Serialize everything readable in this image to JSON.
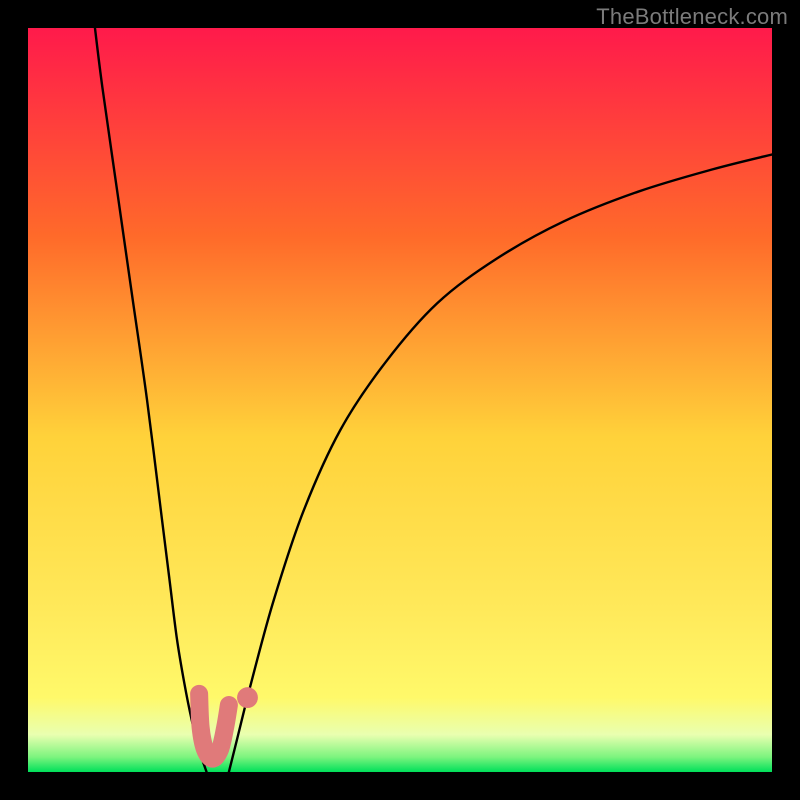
{
  "watermark": "TheBottleneck.com",
  "chart_data": {
    "type": "line",
    "title": "",
    "xlabel": "",
    "ylabel": "",
    "xlim": [
      0,
      100
    ],
    "ylim": [
      0,
      100
    ],
    "grid": false,
    "gradient": {
      "top": "#ff1a4b",
      "upper_mid": "#ff7a2a",
      "mid": "#ffd23a",
      "lower_mid": "#fff96a",
      "pale": "#e9ffb0",
      "bottom": "#00e05a"
    },
    "series": [
      {
        "name": "left-branch",
        "stroke": "#000000",
        "x": [
          9,
          10,
          12,
          14,
          16,
          18,
          19,
          20,
          21,
          22,
          23,
          24
        ],
        "y": [
          100,
          92,
          78,
          64,
          50,
          34,
          26,
          18,
          12,
          7,
          3,
          0
        ]
      },
      {
        "name": "right-branch",
        "stroke": "#000000",
        "x": [
          27,
          28,
          30,
          33,
          37,
          42,
          48,
          55,
          63,
          72,
          82,
          92,
          100
        ],
        "y": [
          0,
          4,
          12,
          23,
          35,
          46,
          55,
          63,
          69,
          74,
          78,
          81,
          83
        ]
      }
    ],
    "markers": [
      {
        "name": "left-marker",
        "type": "rounded-u",
        "stroke": "#e07a7a",
        "x": [
          23.0,
          23.2,
          23.8,
          24.8,
          25.8,
          26.5,
          27.0
        ],
        "y": [
          10.5,
          6.0,
          3.0,
          1.8,
          3.0,
          6.0,
          9.0
        ]
      },
      {
        "name": "right-dot",
        "type": "dot",
        "fill": "#e07a7a",
        "cx": 29.5,
        "cy": 10.0,
        "r": 1.4
      }
    ]
  }
}
